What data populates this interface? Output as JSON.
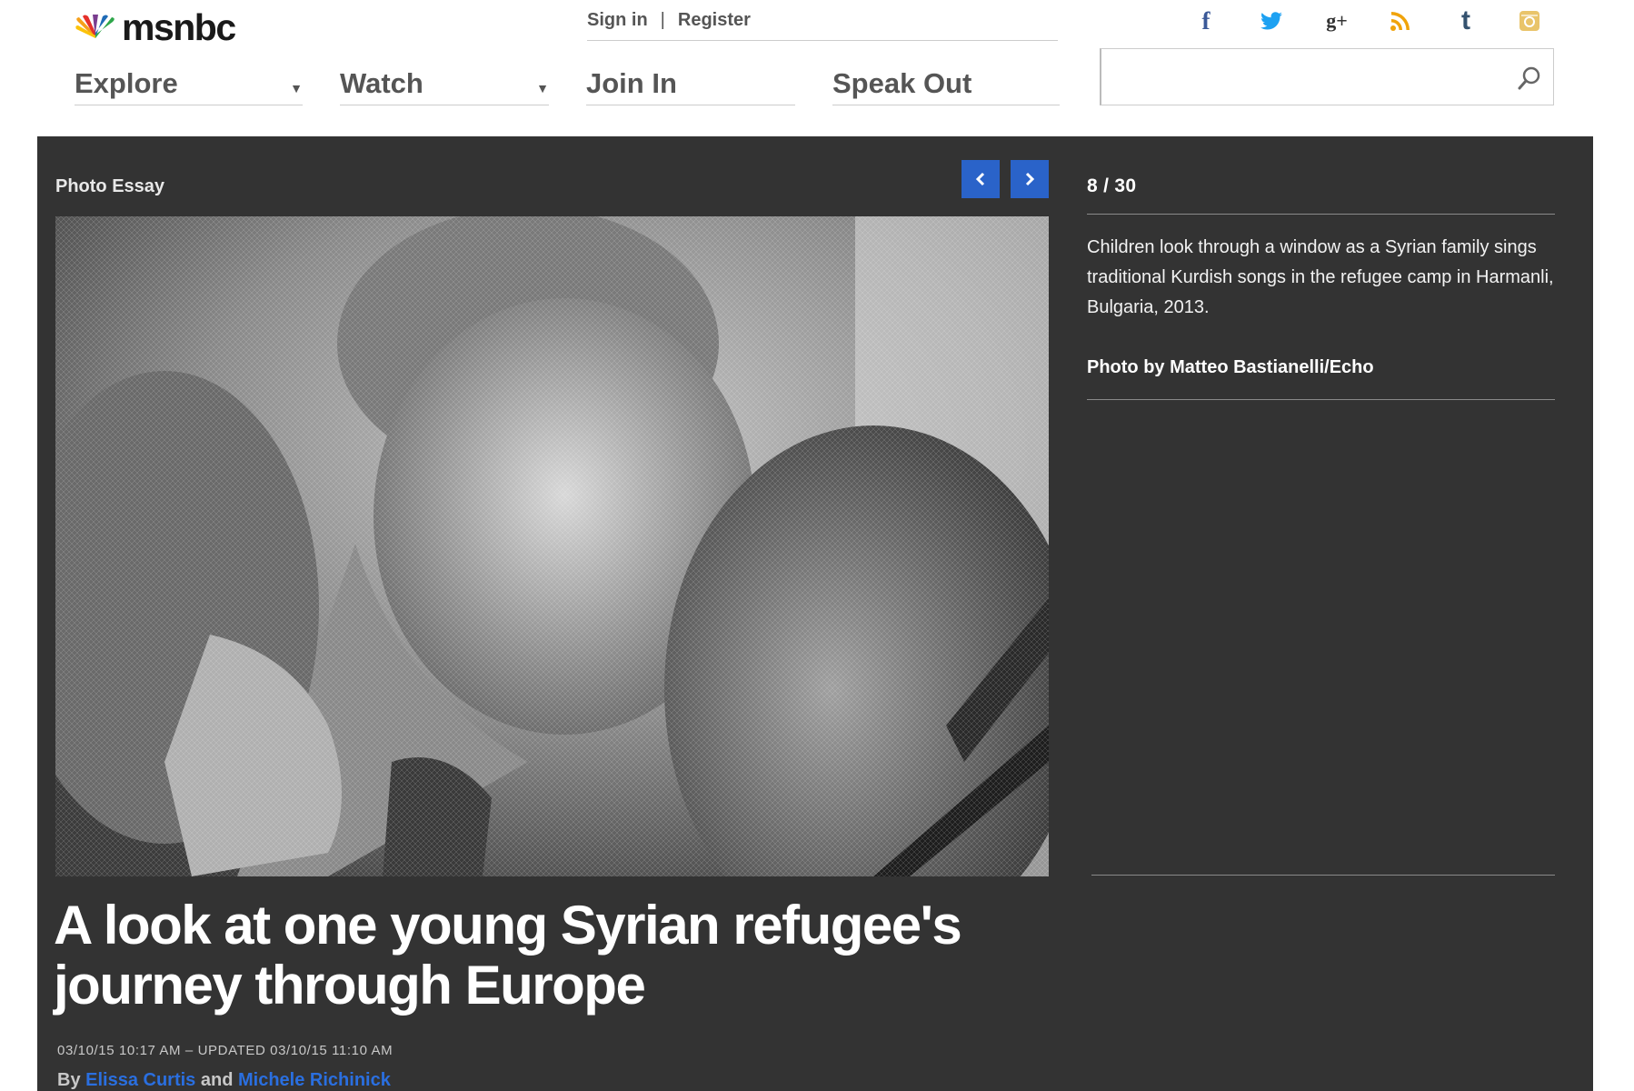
{
  "header": {
    "logo_text": "msnbc",
    "account": {
      "signin": "Sign in",
      "separator": "|",
      "register": "Register"
    },
    "nav": [
      {
        "label": "Explore",
        "has_dropdown": true
      },
      {
        "label": "Watch",
        "has_dropdown": true
      },
      {
        "label": "Join In",
        "has_dropdown": false
      },
      {
        "label": "Speak Out",
        "has_dropdown": false
      }
    ],
    "social_icons": [
      "facebook-icon",
      "twitter-icon",
      "google-plus-icon",
      "rss-icon",
      "tumblr-icon",
      "instagram-icon"
    ],
    "social_glyphs": {
      "facebook": "f",
      "google_plus": "g+",
      "tumblr": "t"
    },
    "search": {
      "value": "",
      "placeholder": ""
    }
  },
  "gallery": {
    "section_label": "Photo Essay",
    "counter": "8 / 30",
    "caption": "Children look through a window as a Syrian family sings traditional Kurdish songs in the refugee camp in Harmanli, Bulgaria, 2013.",
    "credit": "Photo by Matteo Bastianelli/Echo",
    "image_description": "children-behind-window-photo"
  },
  "article": {
    "headline": "A look at one young Syrian refugee's journey through Europe",
    "dateline": "03/10/15 10:17 AM – UPDATED 03/10/15 11:10 AM",
    "byline": {
      "prefix": "By",
      "author1": "Elissa Curtis",
      "conj": "and",
      "author2": "Michele Richinick"
    }
  },
  "colors": {
    "dark_bg": "#333333",
    "accent_blue": "#2a63c9",
    "link_blue": "#2a6fe0",
    "facebook": "#3b5998",
    "twitter": "#1da1f2",
    "rss": "#f0a30a",
    "tumblr": "#34526f",
    "instagram": "#e9c46a"
  }
}
